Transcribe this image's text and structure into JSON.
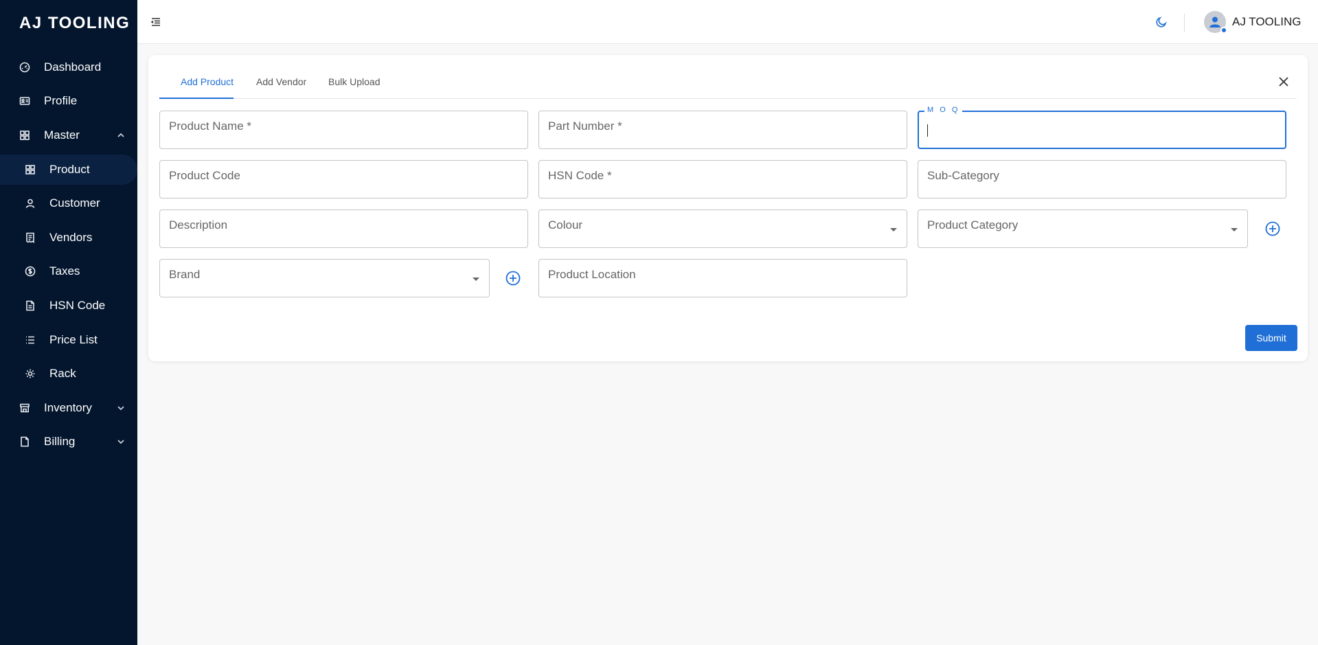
{
  "sidebar": {
    "brand": "AJ TOOLING",
    "items": [
      {
        "label": "Dashboard",
        "icon": "dashboard-icon"
      },
      {
        "label": "Profile",
        "icon": "id-card-icon"
      },
      {
        "label": "Master",
        "icon": "grid-icon",
        "expanded": true
      },
      {
        "label": "Product",
        "icon": "grid-icon",
        "active": true
      },
      {
        "label": "Customer",
        "icon": "user-icon"
      },
      {
        "label": "Vendors",
        "icon": "receipt-icon"
      },
      {
        "label": "Taxes",
        "icon": "dollar-circle-icon"
      },
      {
        "label": "HSN Code",
        "icon": "document-icon"
      },
      {
        "label": "Price List",
        "icon": "list-icon"
      },
      {
        "label": "Rack",
        "icon": "gear-icon"
      },
      {
        "label": "Inventory",
        "icon": "store-icon",
        "expanded": false
      },
      {
        "label": "Billing",
        "icon": "document-icon",
        "expanded": false
      }
    ]
  },
  "header": {
    "user_name": "AJ TOOLING",
    "accent_color": "#1f6fd6"
  },
  "tabs": [
    {
      "label": "Add Product",
      "active": true
    },
    {
      "label": "Add Vendor",
      "active": false
    },
    {
      "label": "Bulk Upload",
      "active": false
    }
  ],
  "form": {
    "product_name": "Product Name *",
    "part_number": "Part Number *",
    "moq": "M O Q",
    "moq_value": "",
    "product_code": "Product Code",
    "hsn_code": "HSN Code *",
    "sub_category": "Sub-Category",
    "description": "Description",
    "colour": "Colour",
    "product_category": "Product Category",
    "brand": "Brand",
    "product_location": "Product Location",
    "submit_label": "Submit"
  }
}
